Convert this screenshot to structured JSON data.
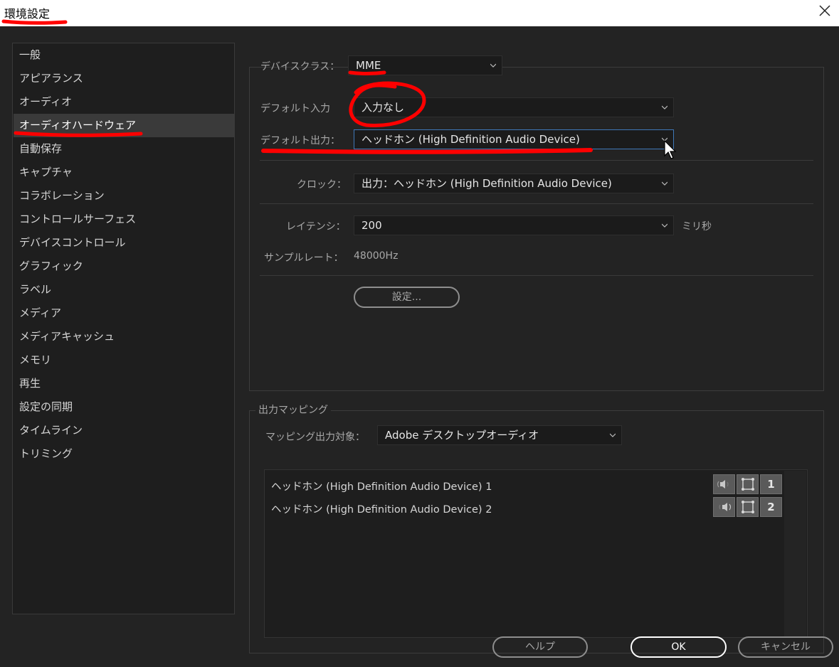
{
  "window": {
    "title": "環境設定"
  },
  "sidebar": {
    "items": [
      {
        "label": "一般"
      },
      {
        "label": "アピアランス"
      },
      {
        "label": "オーディオ"
      },
      {
        "label": "オーディオハードウェア",
        "selected": true
      },
      {
        "label": "自動保存"
      },
      {
        "label": "キャプチャ"
      },
      {
        "label": "コラボレーション"
      },
      {
        "label": "コントロールサーフェス"
      },
      {
        "label": "デバイスコントロール"
      },
      {
        "label": "グラフィック"
      },
      {
        "label": "ラベル"
      },
      {
        "label": "メディア"
      },
      {
        "label": "メディアキャッシュ"
      },
      {
        "label": "メモリ"
      },
      {
        "label": "再生"
      },
      {
        "label": "設定の同期"
      },
      {
        "label": "タイムライン"
      },
      {
        "label": "トリミング"
      }
    ]
  },
  "hardware": {
    "device_class_label": "デバイスクラス：",
    "device_class_value": "MME",
    "default_input_label": "デフォルト入力",
    "default_input_value": "入力なし",
    "default_output_label": "デフォルト出力：",
    "default_output_value": "ヘッドホン (High Definition Audio Device)",
    "clock_label": "クロック：",
    "clock_value": "出力：ヘッドホン (High Definition Audio Device)",
    "latency_label": "レイテンシ：",
    "latency_value": "200",
    "latency_unit": "ミリ秒",
    "sample_rate_label": "サンプルレート：",
    "sample_rate_value": "48000Hz",
    "settings_button": "設定..."
  },
  "output_mapping": {
    "legend": "出力マッピング",
    "target_label": "マッピング出力対象：",
    "target_value": "Adobe デスクトップオーディオ",
    "rows": [
      {
        "label": "ヘッドホン (High Definition Audio Device) 1",
        "channel": "1"
      },
      {
        "label": "ヘッドホン (High Definition Audio Device) 2",
        "channel": "2"
      }
    ]
  },
  "footer": {
    "help": "ヘルプ",
    "ok": "OK",
    "cancel": "キャンセル"
  },
  "colors": {
    "background": "#232323",
    "annotation": "#ff0000",
    "focus": "#3f78b8"
  }
}
